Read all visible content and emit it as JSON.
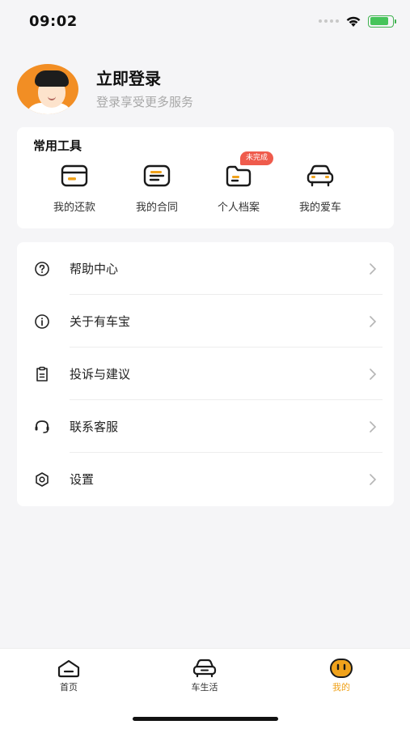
{
  "status_bar": {
    "time": "09:02",
    "battery_level": 0.85,
    "battery_color": "#46c45a"
  },
  "profile": {
    "title": "立即登录",
    "subtitle": "登录享受更多服务",
    "avatar_icon": "user-avatar-illustration"
  },
  "tools": {
    "title": "常用工具",
    "items": [
      {
        "label": "我的还款",
        "icon": "wallet-icon"
      },
      {
        "label": "我的合同",
        "icon": "contract-icon"
      },
      {
        "label": "个人档案",
        "icon": "folder-icon",
        "badge": "未完成"
      },
      {
        "label": "我的爱车",
        "icon": "car-icon"
      }
    ]
  },
  "menu": {
    "items": [
      {
        "label": "帮助中心",
        "icon": "question-circle-icon"
      },
      {
        "label": "关于有车宝",
        "icon": "info-circle-icon"
      },
      {
        "label": "投诉与建议",
        "icon": "clipboard-icon"
      },
      {
        "label": "联系客服",
        "icon": "headset-icon"
      },
      {
        "label": "设置",
        "icon": "hexagon-settings-icon"
      }
    ]
  },
  "tabbar": {
    "items": [
      {
        "label": "首页",
        "icon": "home-icon"
      },
      {
        "label": "车生活",
        "icon": "car-icon"
      },
      {
        "label": "我的",
        "icon": "smiley-face-icon",
        "active": true
      }
    ],
    "active_color": "#f0a21b"
  },
  "colors": {
    "accent": "#f0a21b",
    "badge": "#ef5b4c",
    "avatar_bg": "#f28e24"
  }
}
